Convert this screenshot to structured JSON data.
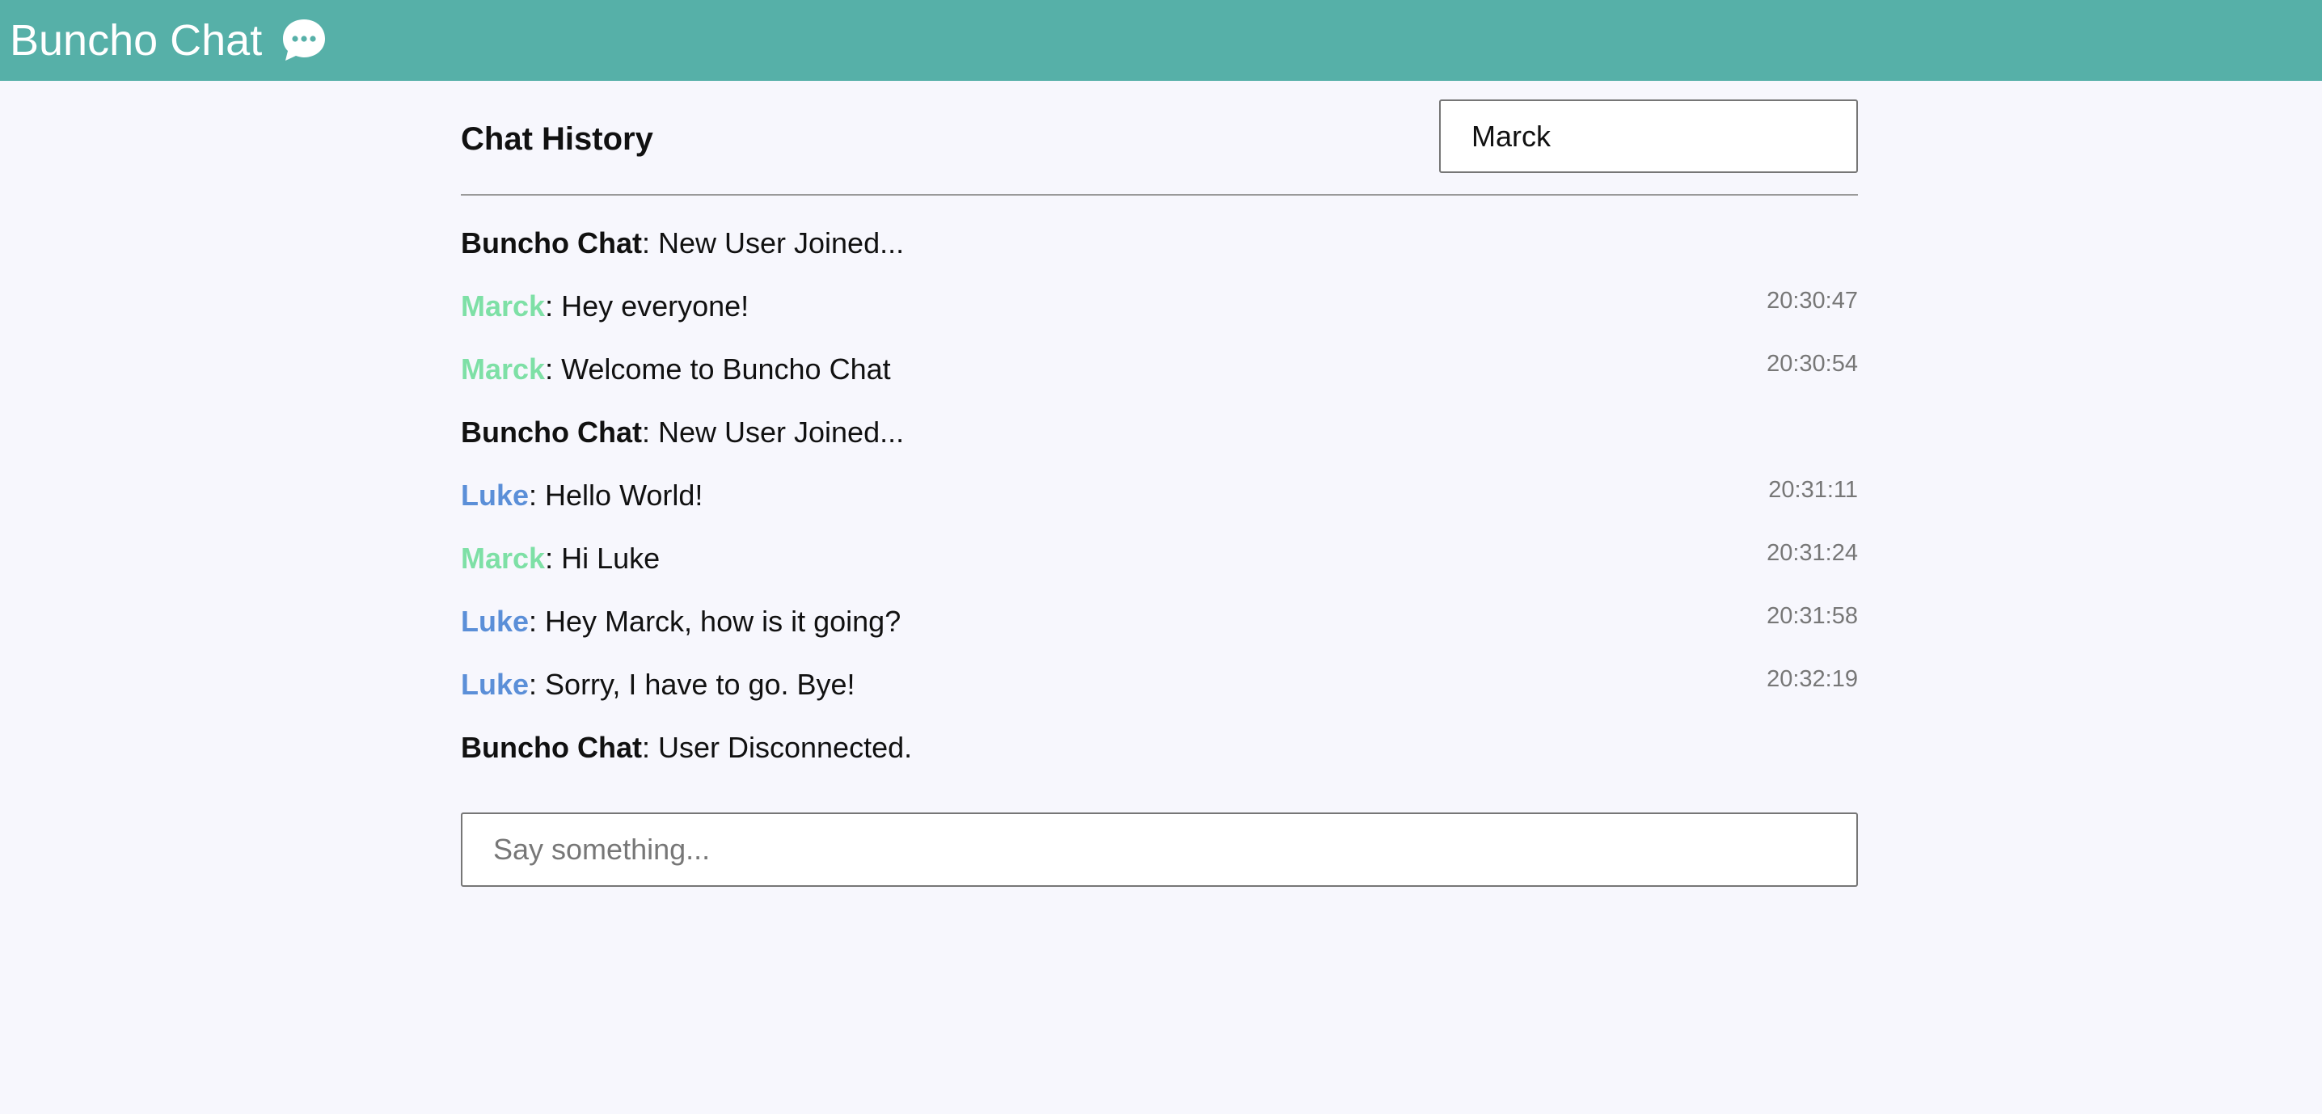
{
  "header": {
    "title": "Buncho Chat",
    "icon": "chat-bubble-icon",
    "background_color": "#56b0a8"
  },
  "chat": {
    "title": "Chat History",
    "username_value": "Marck",
    "compose_placeholder": "Say something...",
    "messages": [
      {
        "sender": "Buncho Chat",
        "text": ": New User Joined...",
        "time": "",
        "sender_color": "#111111"
      },
      {
        "sender": "Marck",
        "text": ": Hey everyone!",
        "time": "20:30:47",
        "sender_color": "#7ee0a6"
      },
      {
        "sender": "Marck",
        "text": ": Welcome to Buncho Chat",
        "time": "20:30:54",
        "sender_color": "#7ee0a6"
      },
      {
        "sender": "Buncho Chat",
        "text": ": New User Joined...",
        "time": "",
        "sender_color": "#111111"
      },
      {
        "sender": "Luke",
        "text": ": Hello World!",
        "time": "20:31:11",
        "sender_color": "#5b8fd8"
      },
      {
        "sender": "Marck",
        "text": ": Hi Luke",
        "time": "20:31:24",
        "sender_color": "#7ee0a6"
      },
      {
        "sender": "Luke",
        "text": ": Hey Marck, how is it going?",
        "time": "20:31:58",
        "sender_color": "#5b8fd8"
      },
      {
        "sender": "Luke",
        "text": ": Sorry, I have to go. Bye!",
        "time": "20:32:19",
        "sender_color": "#5b8fd8"
      },
      {
        "sender": "Buncho Chat",
        "text": ": User Disconnected.",
        "time": "",
        "sender_color": "#111111"
      }
    ]
  }
}
